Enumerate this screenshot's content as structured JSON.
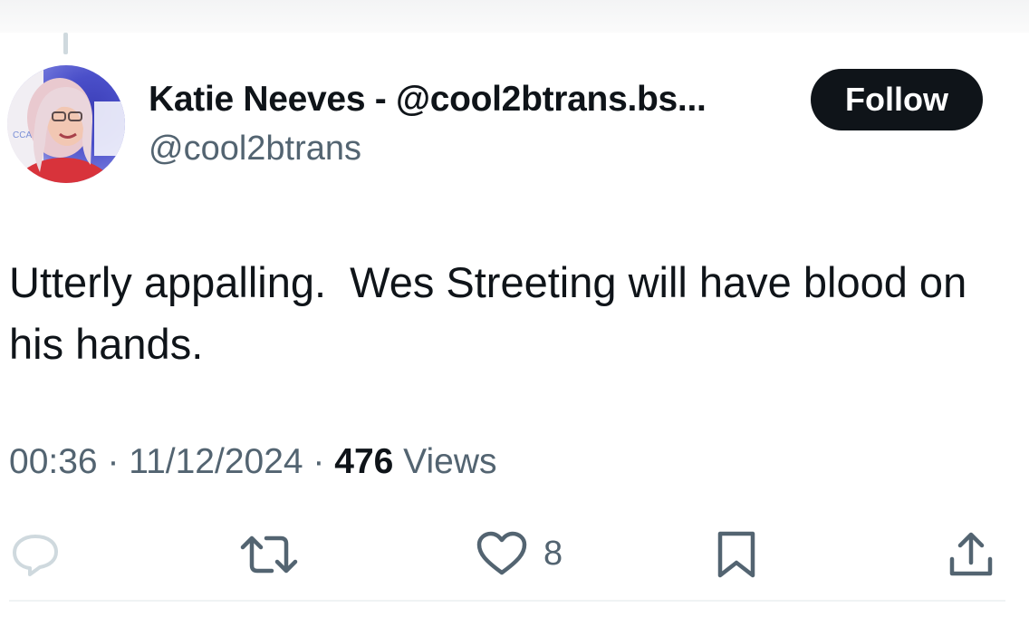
{
  "author": {
    "display_name": "Katie Neeves - @cool2btrans.bs...",
    "handle": "@cool2btrans",
    "avatar_icon": "profile-photo"
  },
  "follow_label": "Follow",
  "tweet": {
    "text": "Utterly appalling.  Wes Streeting will have blood on his hands."
  },
  "meta": {
    "time": "00:36",
    "separator": " · ",
    "date": "11/12/2024",
    "views_count": "476",
    "views_label": " Views"
  },
  "actions": {
    "reply_icon": "reply-icon",
    "retweet_icon": "retweet-icon",
    "like_icon": "heart-icon",
    "like_count": "8",
    "bookmark_icon": "bookmark-icon",
    "share_icon": "share-icon"
  },
  "colors": {
    "text_primary": "#0f1419",
    "text_secondary": "#536471",
    "follow_bg": "#0f1419",
    "reply_icon_faded": "#cfd9de"
  }
}
